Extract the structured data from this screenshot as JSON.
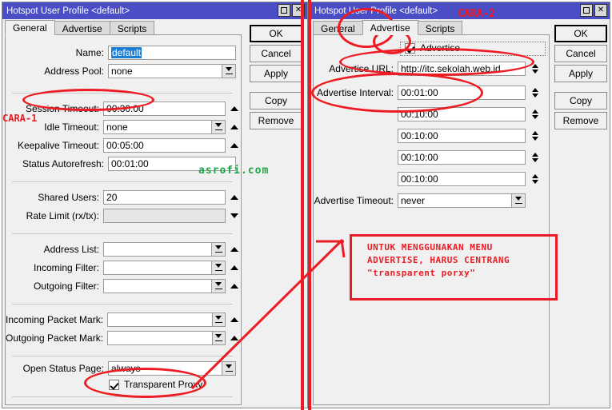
{
  "left_window": {
    "title": "Hotspot User Profile <default>",
    "titlebar_buttons": {
      "maximize": "maximize-icon",
      "close": "✕"
    },
    "tabs": [
      {
        "label": "General",
        "active": true
      },
      {
        "label": "Advertise",
        "active": false
      },
      {
        "label": "Scripts",
        "active": false
      }
    ],
    "fields": [
      {
        "label": "Name:",
        "value": "default",
        "selected": true
      },
      {
        "label": "Address Pool:",
        "value": "none"
      },
      {
        "label": "Session Timeout:",
        "value": "00:30:00"
      },
      {
        "label": "Idle Timeout:",
        "value": "none"
      },
      {
        "label": "Keepalive Timeout:",
        "value": "00:05:00"
      },
      {
        "label": "Status Autorefresh:",
        "value": "00:01:00"
      },
      {
        "label": "Shared Users:",
        "value": "20"
      },
      {
        "label": "Rate Limit (rx/tx):",
        "value": ""
      },
      {
        "label": "Address List:",
        "value": ""
      },
      {
        "label": "Incoming Filter:",
        "value": ""
      },
      {
        "label": "Outgoing Filter:",
        "value": ""
      },
      {
        "label": "Incoming Packet Mark:",
        "value": ""
      },
      {
        "label": "Outgoing Packet Mark:",
        "value": ""
      },
      {
        "label": "Open Status Page:",
        "value": "always"
      }
    ],
    "checkbox": {
      "label": "Transparent Proxy",
      "checked": true
    },
    "buttons": [
      "OK",
      "Cancel",
      "Apply",
      "Copy",
      "Remove"
    ]
  },
  "right_window": {
    "title": "Hotspot User Profile <default>",
    "titlebar_buttons": {
      "maximize": "maximize-icon",
      "close": "✕"
    },
    "tabs": [
      {
        "label": "General",
        "active": false
      },
      {
        "label": "Advertise",
        "active": true
      },
      {
        "label": "Scripts",
        "active": false
      }
    ],
    "advertise_checkbox": {
      "label": "Advertise",
      "checked": true
    },
    "fields": [
      {
        "label": "Advertise URL:",
        "value": "http://itc.sekolah.web.id"
      },
      {
        "label": "Advertise Interval:",
        "value": "00:01:00"
      },
      {
        "label": "",
        "value": "00:10:00"
      },
      {
        "label": "",
        "value": "00:10:00"
      },
      {
        "label": "",
        "value": "00:10:00"
      },
      {
        "label": "",
        "value": "00:10:00"
      },
      {
        "label": "Advertise Timeout:",
        "value": "never"
      }
    ],
    "buttons": [
      "OK",
      "Cancel",
      "Apply",
      "Copy",
      "Remove"
    ]
  },
  "annotations": {
    "cara1": "CARA-1",
    "cara2": "CARA-2",
    "note_line1": "UNTUK MENGGUNAKAN MENU",
    "note_line2": "ADVERTISE, HARUS CENTRANG",
    "note_line3": "\"transparent porxy\"",
    "watermark": "asrofi.com",
    "accent_color": "#ed1c24",
    "watermark_color": "#22a44c"
  }
}
